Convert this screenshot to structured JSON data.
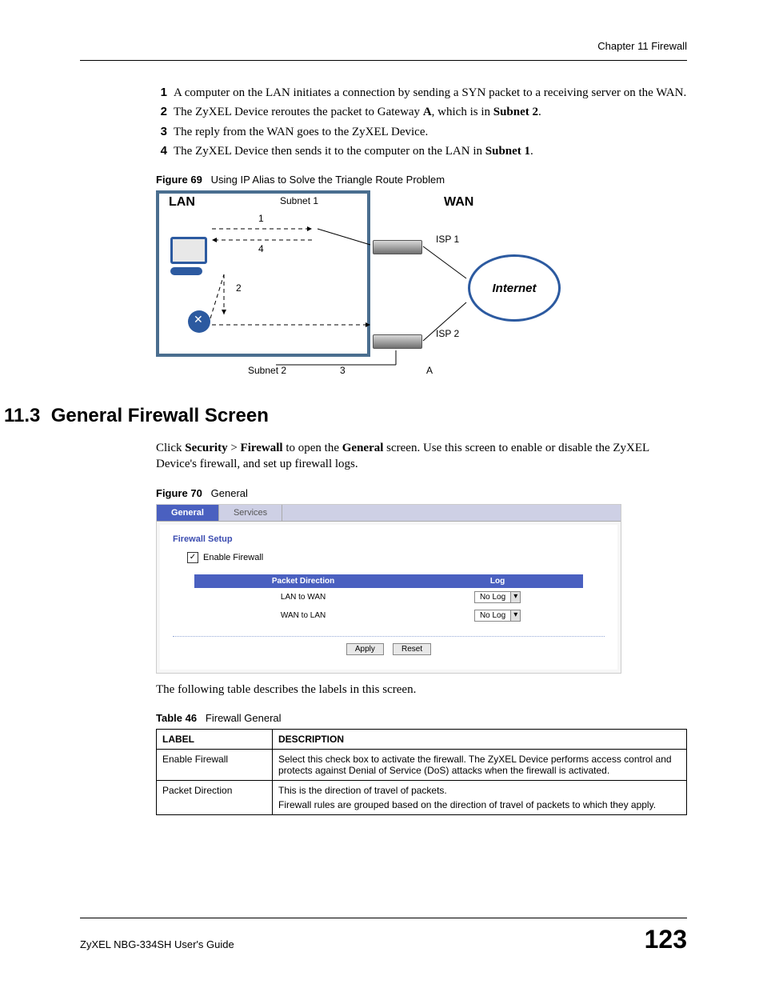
{
  "header": {
    "chapter": "Chapter 11 Firewall"
  },
  "steps": {
    "n1": "1",
    "t1a": "A computer on the LAN initiates a connection by sending a SYN packet to a receiving server on the WAN.",
    "n2": "2",
    "t2a": "The ZyXEL Device reroutes the packet to Gateway ",
    "t2b": "A",
    "t2c": ", which is in ",
    "t2d": "Subnet 2",
    "t2e": ".",
    "n3": "3",
    "t3a": "The reply from the WAN goes to the ZyXEL Device.",
    "n4": "4",
    "t4a": "The ZyXEL Device then sends it to the computer on the LAN in ",
    "t4b": "Subnet 1",
    "t4c": "."
  },
  "fig69": {
    "num": "Figure 69",
    "title": "Using IP Alias to Solve the Triangle Route Problem"
  },
  "diagram": {
    "lan": "LAN",
    "wan": "WAN",
    "subnet1": "Subnet 1",
    "subnet2": "Subnet 2",
    "isp1": "ISP 1",
    "isp2": "ISP 2",
    "internet": "Internet",
    "n1": "1",
    "n2": "2",
    "n3": "3",
    "n4": "4",
    "a": "A"
  },
  "section": {
    "num": "11.3",
    "title": "General Firewall Screen"
  },
  "intro": {
    "a": "Click ",
    "b": "Security",
    "c": " > ",
    "d": "Firewall",
    "e": " to open the ",
    "f": "General",
    "g": " screen. Use this screen to enable or disable the ZyXEL Device's firewall, and set up firewall logs."
  },
  "fig70": {
    "num": "Figure 70",
    "title": "General"
  },
  "ui": {
    "tab_general": "General",
    "tab_services": "Services",
    "heading": "Firewall Setup",
    "checkbox_label": "Enable Firewall",
    "check_mark": "✓",
    "col_pd": "Packet Direction",
    "col_log": "Log",
    "row1": "LAN to WAN",
    "row2": "WAN to LAN",
    "sel": "No Log",
    "arrow": "▾",
    "apply": "Apply",
    "reset": "Reset"
  },
  "postpara": "The following table describes the labels in this screen.",
  "table46": {
    "num": "Table 46",
    "title": "Firewall General",
    "h_label": "LABEL",
    "h_desc": "DESCRIPTION",
    "r1_label": "Enable Firewall",
    "r1_desc": "Select this check box to activate the firewall. The ZyXEL Device performs access control and protects against Denial of Service (DoS) attacks when the firewall is activated.",
    "r2_label": "Packet Direction",
    "r2_desc1": "This is the direction of travel of packets.",
    "r2_desc2": "Firewall rules are grouped based on the direction of travel of packets to which they apply."
  },
  "footer": {
    "guide": "ZyXEL NBG-334SH User's Guide",
    "page": "123"
  }
}
